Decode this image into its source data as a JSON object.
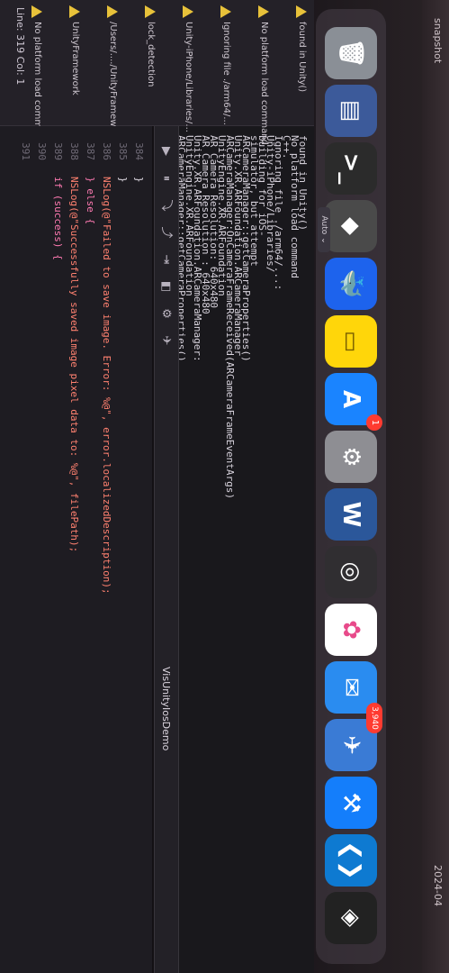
{
  "wallpaper": {
    "labels": [
      "snapshot",
      "2024-04"
    ]
  },
  "dock": {
    "apps": [
      {
        "name": "Trash",
        "icon": "trash-icon",
        "color": "#8a8f96",
        "glyph": "🗑"
      },
      {
        "name": "Preview",
        "icon": "preview-icon",
        "color": "#3c5a9a",
        "glyph": "▤"
      },
      {
        "name": "Terminal",
        "icon": "terminal-icon",
        "color": "#2b2b2b",
        "glyph": ">_"
      },
      {
        "name": "Unity Hub",
        "icon": "unity-icon",
        "color": "#4a4a4a",
        "glyph": "◆"
      },
      {
        "name": "Docker",
        "icon": "docker-icon",
        "color": "#1d63ed",
        "glyph": "🐳"
      },
      {
        "name": "Notes",
        "icon": "notes-icon",
        "color": "#ffd60a",
        "glyph": "▭"
      },
      {
        "name": "App Store",
        "icon": "app-store-icon",
        "color": "#1a84ff",
        "glyph": "A"
      },
      {
        "name": "System Settings",
        "icon": "settings-icon",
        "color": "#8e8e93",
        "glyph": "⚙"
      },
      {
        "name": "Microsoft Word",
        "icon": "word-icon",
        "color": "#2b579a",
        "glyph": "W"
      },
      {
        "name": "OBS",
        "icon": "obs-icon",
        "color": "#302e31",
        "glyph": "◎"
      },
      {
        "name": "Photos",
        "icon": "photos-icon",
        "color": "#ffffff",
        "glyph": "✿"
      },
      {
        "name": "Mail",
        "icon": "mail-icon",
        "color": "#2a8cf0",
        "glyph": "✉"
      },
      {
        "name": "TestFlight",
        "icon": "testflight-icon",
        "color": "#3a7bd5",
        "glyph": "✈"
      },
      {
        "name": "Xcode",
        "icon": "xcode-icon",
        "color": "#147efb",
        "glyph": "⚒"
      },
      {
        "name": "Visual Studio Code",
        "icon": "vscode-icon",
        "color": "#0e7ad1",
        "glyph": "❮❯"
      },
      {
        "name": "Unity",
        "icon": "unity-app-icon",
        "color": "#222222",
        "glyph": "◈"
      }
    ],
    "badges": [
      {
        "app": "App Store",
        "text": "1"
      },
      {
        "app": "Mail",
        "text": "3,940"
      }
    ],
    "status_tab": "Auto ⌄"
  },
  "debug_bar": {
    "buttons": [
      "▶",
      "⏸",
      "⤵",
      "⤴",
      "⇥",
      "◧",
      "⚙",
      "✈"
    ],
    "target": "VisUnityIosDemo"
  },
  "logs": [
    {
      "text": "found  in Unity()"
    },
    {
      "text": "No platform load command"
    },
    {
      "text": "C++."
    },
    {
      "text": "Ignoring file ./arm64/...:"
    },
    {
      "text": "Unity-iPhone/Libraries/"
    },
    {
      "text": "building for iOS-"
    },
    {
      "text": "simulator, but attempt"
    },
    {
      "text": "ARCameraManager::getCameraProperties()"
    },
    {
      "text": "Unity.XR.ARFoundation.ARCameraManager"
    },
    {
      "text": "ARCameraManager:OnCameraFrameReceived(ARCameraFrameEventArgs)"
    },
    {
      "text": "UnityEngine.XR.ARFoundation"
    },
    {
      "text": "AR Camera Resolution: 640x480"
    },
    {
      "text": "AR Camera Resolution : 640x480"
    },
    {
      "text": "Unity.XR.ARFoundation.ARCameraManager:"
    },
    {
      "text": "UnityEngine.XR.ARFoundation"
    },
    {
      "text": "ARCameraManager::getCameraProperties()"
    }
  ],
  "warnings": [
    {
      "text": "found  in Unity()"
    },
    {
      "text": "No platform load command"
    },
    {
      "text": "Ignoring file ./arm64/..."
    },
    {
      "text": "Unity-iPhone/Libraries/..."
    },
    {
      "text": "lock_detection"
    },
    {
      "text": "/Users/..../UnityFramework/"
    },
    {
      "text": "UnityFramework"
    },
    {
      "text": "No platform load command"
    }
  ],
  "code": {
    "lines": [
      {
        "num": "384",
        "text": "}"
      },
      {
        "num": "385",
        "text": "    }"
      },
      {
        "num": "386",
        "text": "        NSLog(@\"Failed to save image. Error: %@\", error.localizedDescription);"
      },
      {
        "num": "387",
        "text": "    } else {"
      },
      {
        "num": "388",
        "text": "        NSLog(@\"Successfully saved image pixel data to: %@\", filePath);"
      },
      {
        "num": "389",
        "text": "    if (success) {"
      },
      {
        "num": "390",
        "text": ""
      },
      {
        "num": "391",
        "text": ""
      }
    ]
  },
  "status": {
    "line_col": "Line: 319  Col: 1"
  },
  "colors": {
    "warning": "#e8c23a",
    "string": "#ff8170",
    "keyword": "#ff7ab2",
    "badge": "#ff3b30"
  }
}
